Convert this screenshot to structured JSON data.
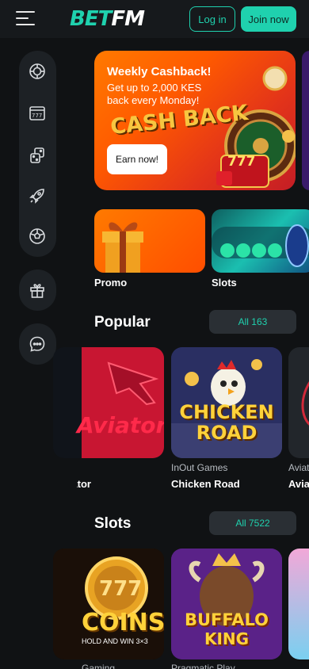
{
  "header": {
    "logo_part1": "BET",
    "logo_part2": "FM",
    "login_label": "Log in",
    "join_label": "Join now"
  },
  "sidebar": {
    "items": [
      {
        "icon": "casino-chip-icon"
      },
      {
        "icon": "slot-machine-icon"
      },
      {
        "icon": "dice-icon"
      },
      {
        "icon": "rocket-icon"
      },
      {
        "icon": "football-icon"
      }
    ],
    "gift_icon": "gift-icon",
    "chat_icon": "chat-icon"
  },
  "banner": {
    "title": "Weekly Cashback!",
    "subtitle": "Get up to 2,000 KES back every Monday!",
    "button_label": "Earn now!",
    "art_text": "CASH BACK",
    "art_number": "777"
  },
  "categories": [
    {
      "label": "Promo"
    },
    {
      "label": "Slots"
    }
  ],
  "popular": {
    "title": "Popular",
    "all_label": "All 163",
    "games": [
      {
        "name": "Aviator",
        "provider": "",
        "art_text": "Aviator"
      },
      {
        "name": "Chicken Road",
        "provider": "InOut Games",
        "art_text_1": "CHICKEN",
        "art_text_2": "ROAD"
      },
      {
        "name": "Avia",
        "provider": "Aviat"
      }
    ]
  },
  "slots": {
    "title": "Slots",
    "all_label": "All 7522",
    "games": [
      {
        "name": "",
        "provider": "Gaming",
        "art_text_1": "777",
        "art_text_2": "COINS",
        "art_text_3": "HOLD AND WIN 3×3"
      },
      {
        "name": "",
        "provider": "Pragmatic Play",
        "art_text_1": "BUFFALO",
        "art_text_2": "KING"
      },
      {
        "name": "",
        "provider": ""
      }
    ]
  },
  "colors": {
    "accent": "#1fd1ae",
    "background": "#101214",
    "panel": "#1d2125"
  }
}
